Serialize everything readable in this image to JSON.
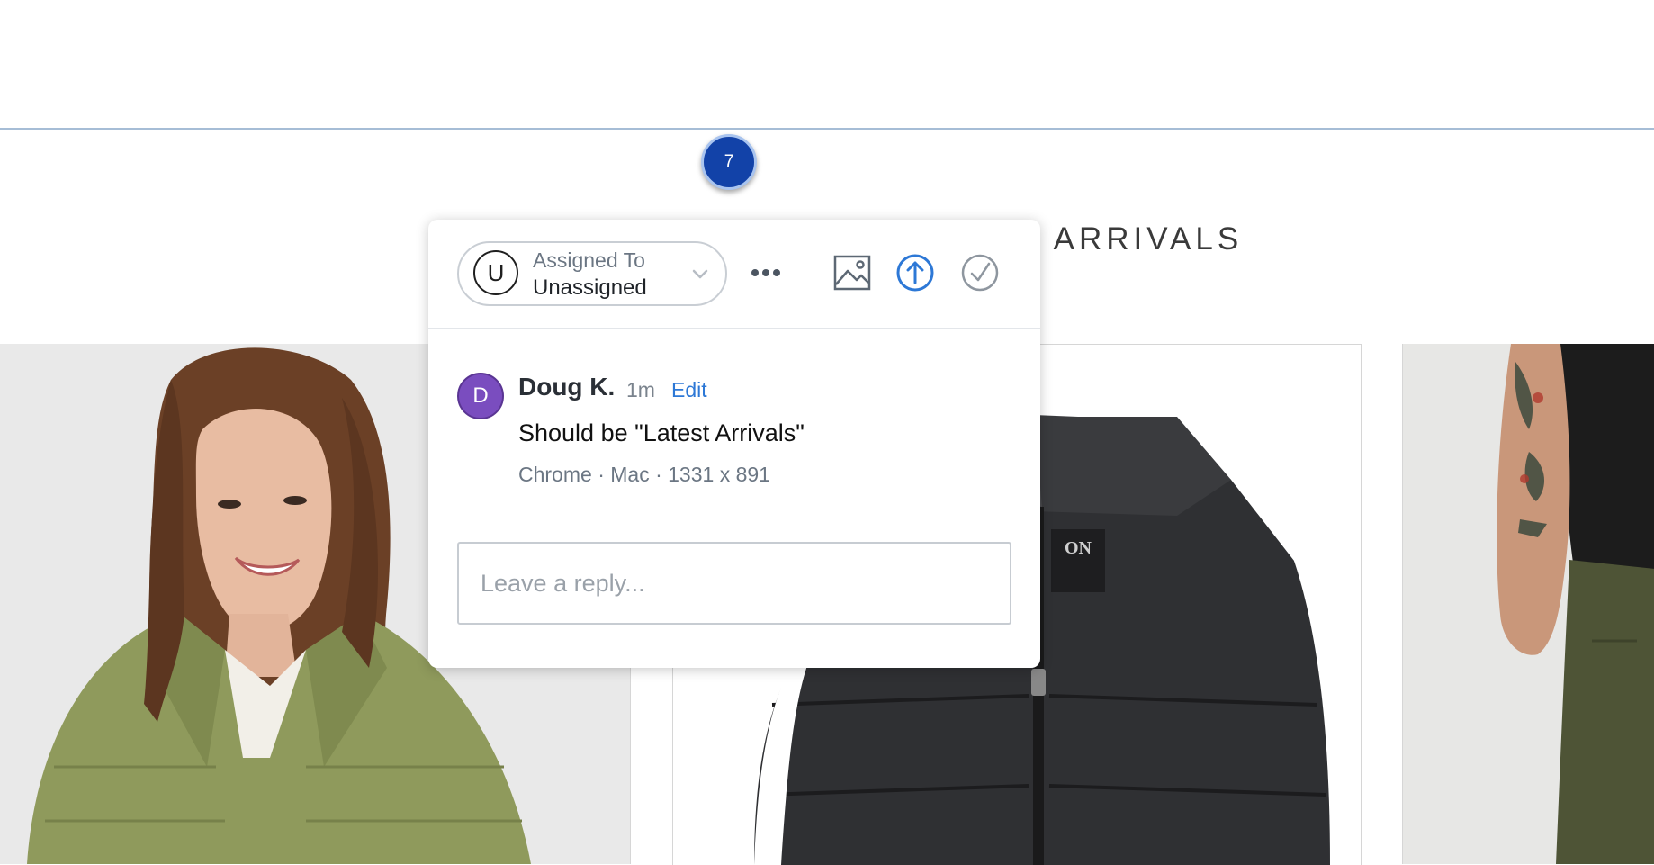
{
  "page": {
    "section_heading": "LATEST ARRIVALS"
  },
  "pin": {
    "number": "7",
    "color": "#1242a8"
  },
  "comment_popover": {
    "assignee": {
      "avatar_letter": "U",
      "title": "Assigned To",
      "value": "Unassigned"
    },
    "toolbar_icons": [
      "more-icon",
      "image-icon",
      "push-icon",
      "resolve-check-icon"
    ],
    "comment": {
      "avatar_letter": "D",
      "avatar_color": "#7a4dbf",
      "author": "Doug K.",
      "time": "1m",
      "edit_label": "Edit",
      "text": "Should be \"Latest Arrivals\"",
      "meta": "Chrome · Mac · 1331 x 891"
    },
    "reply_placeholder": "Leave a reply..."
  },
  "products": [
    {
      "name": "product-tile-green-jacket",
      "description_icon": "photo"
    },
    {
      "name": "product-tile-black-vest",
      "description_icon": "photo"
    },
    {
      "name": "product-tile-olive-pants",
      "description_icon": "photo"
    }
  ],
  "colors": {
    "accent_blue": "#2d78d6",
    "rule": "#a6bdd6"
  }
}
